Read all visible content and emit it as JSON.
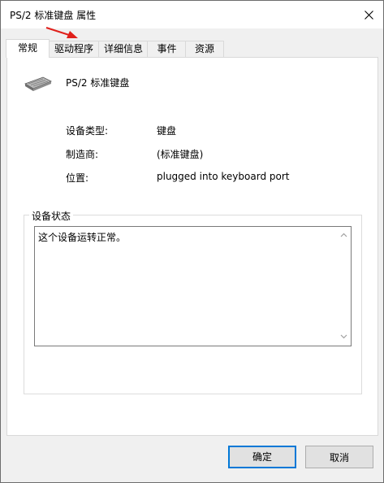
{
  "window": {
    "title": "PS/2 标准键盘 属性",
    "close_icon": "close-icon"
  },
  "tabs": [
    {
      "label": "常规",
      "active": true
    },
    {
      "label": "驱动程序",
      "active": false
    },
    {
      "label": "详细信息",
      "active": false
    },
    {
      "label": "事件",
      "active": false
    },
    {
      "label": "资源",
      "active": false
    }
  ],
  "general": {
    "device_icon": "keyboard-icon",
    "device_name": "PS/2 标准键盘",
    "properties": [
      {
        "label": "设备类型:",
        "value": "键盘"
      },
      {
        "label": "制造商:",
        "value": "(标准键盘)"
      },
      {
        "label": "位置:",
        "value": "plugged into keyboard port"
      }
    ],
    "status_group_label": "设备状态",
    "status_text": "这个设备运转正常。"
  },
  "buttons": {
    "ok": "确定",
    "cancel": "取消"
  },
  "colors": {
    "annotation_arrow": "#e0201b",
    "primary_button_border": "#0078d7"
  }
}
